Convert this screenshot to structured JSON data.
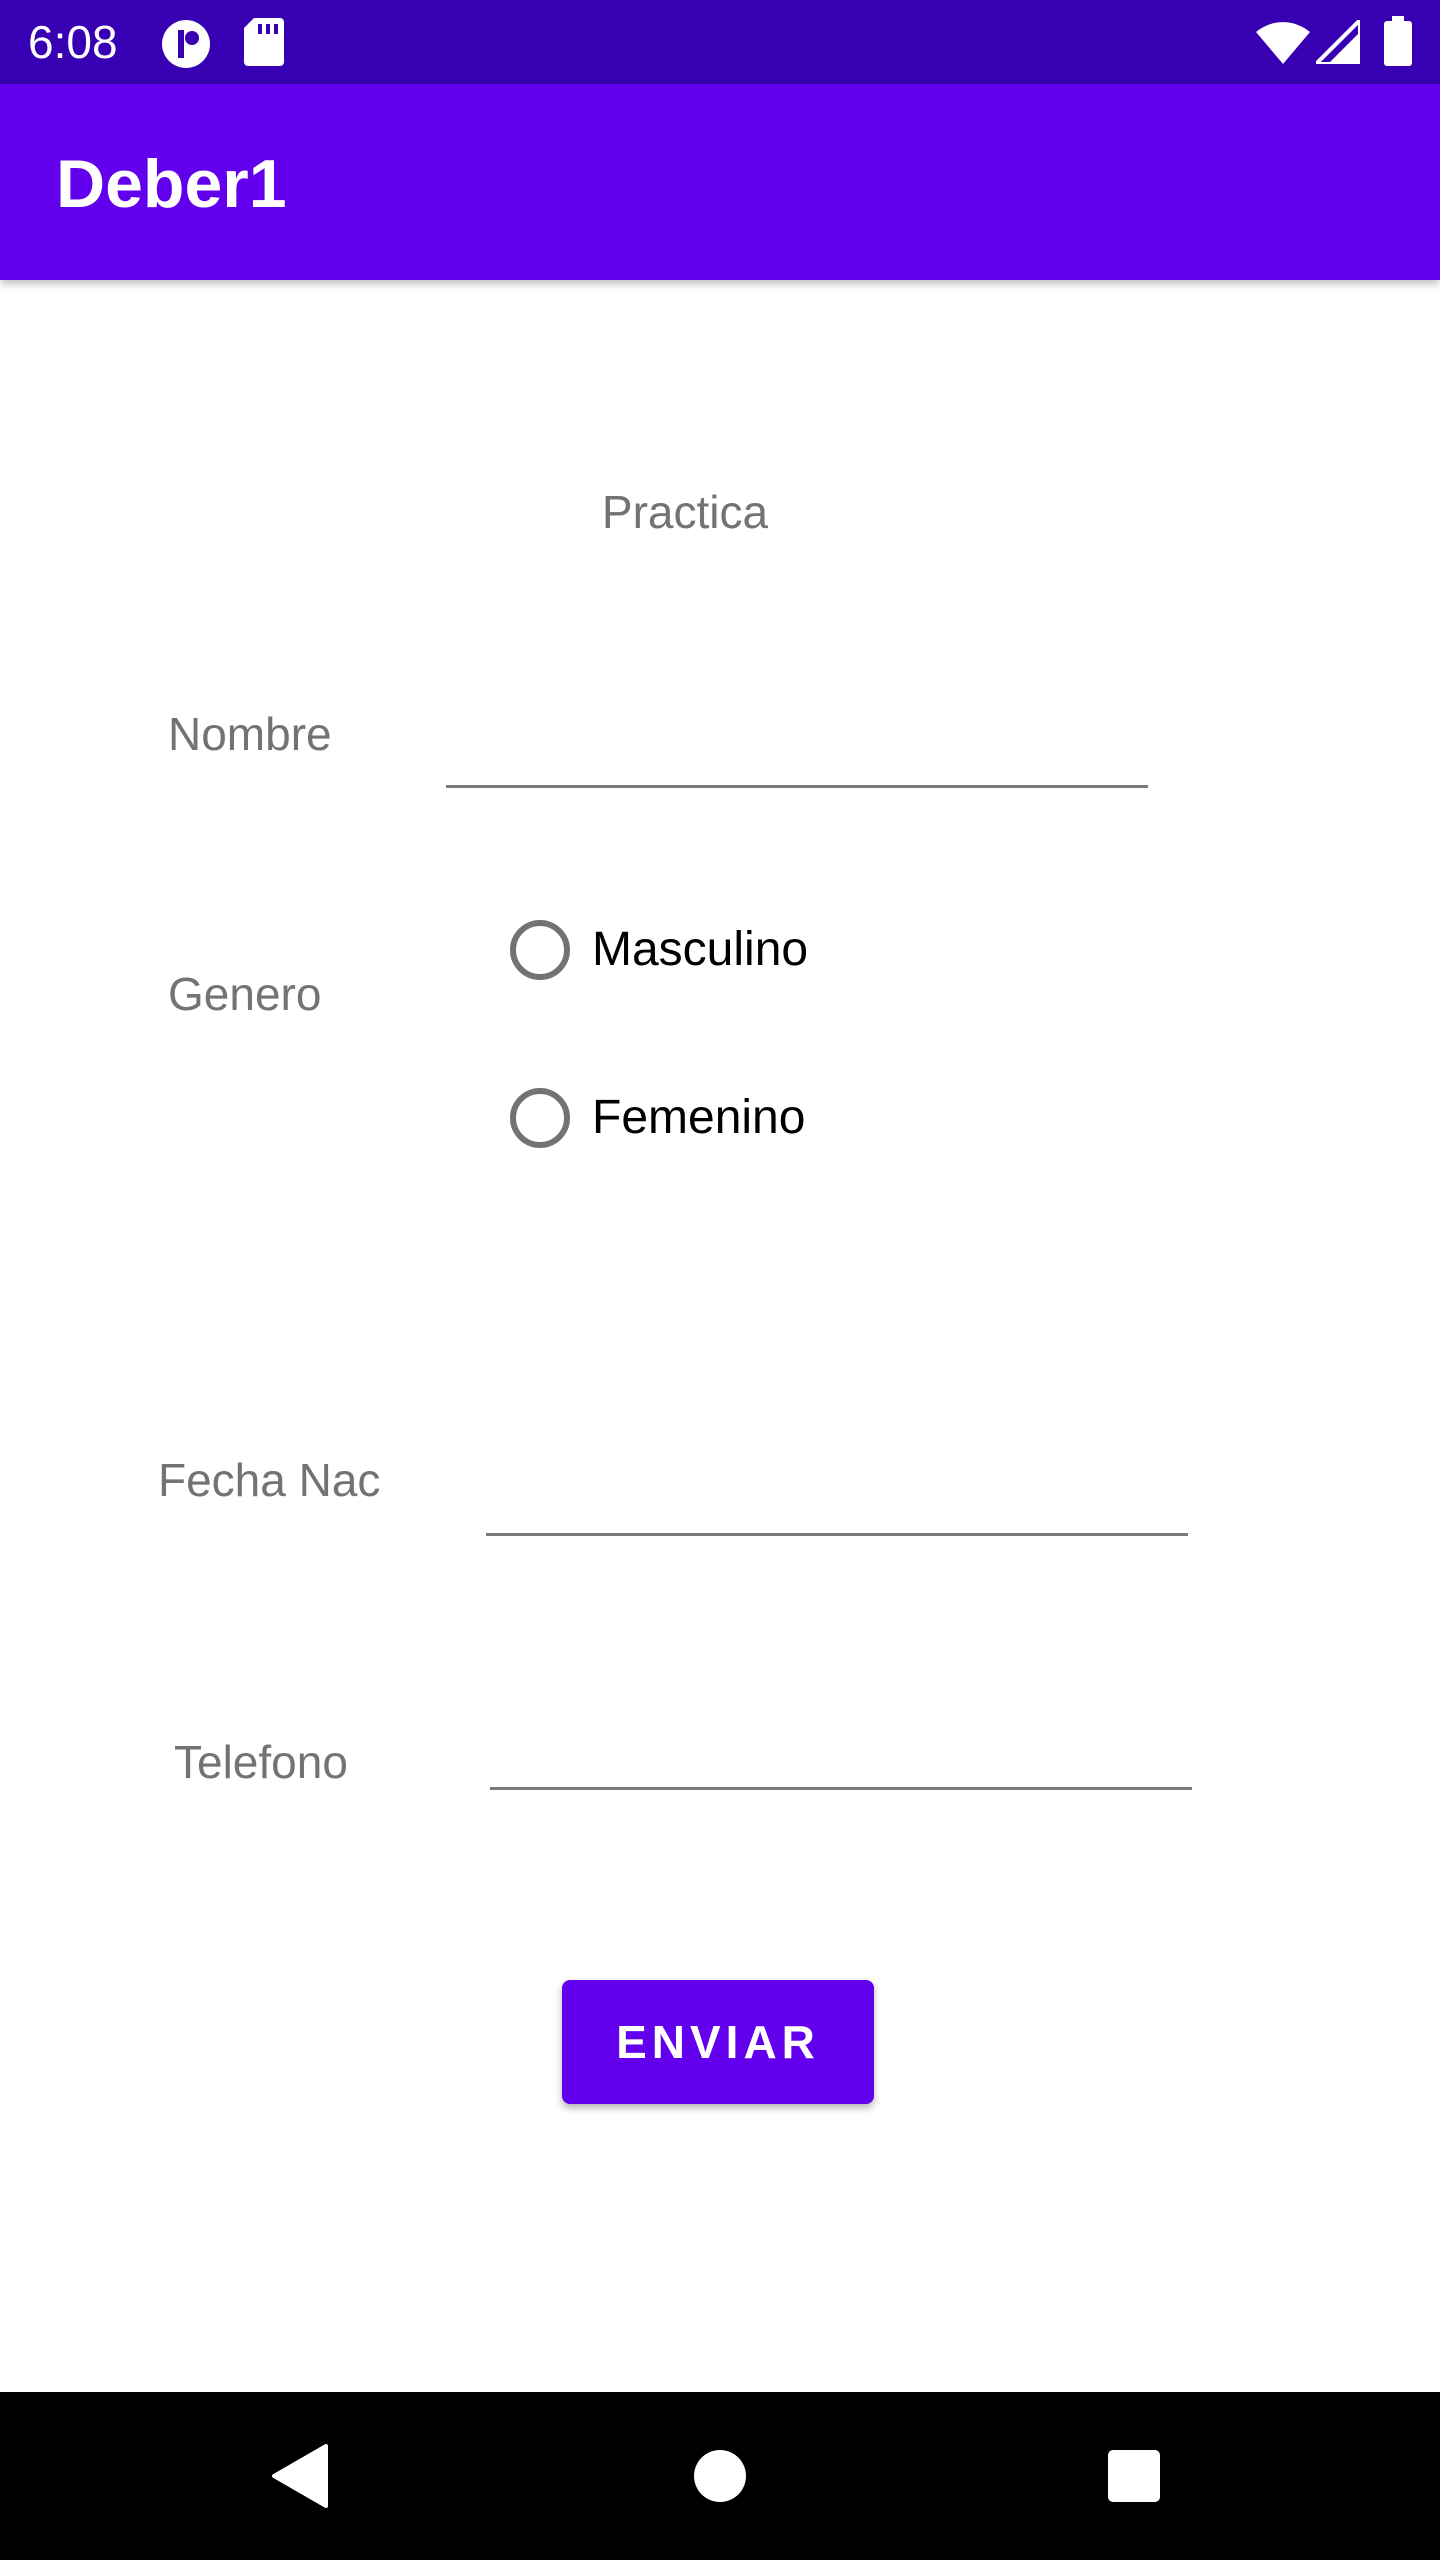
{
  "status_bar": {
    "time": "6:08",
    "icons": [
      "notification-app-icon",
      "sd-card-icon",
      "wifi-icon",
      "cell-signal-icon",
      "battery-icon"
    ]
  },
  "app_bar": {
    "title": "Deber1",
    "color": "#6200ee",
    "status_color": "#3700b3"
  },
  "form": {
    "heading": "Practica",
    "nombre_label": "Nombre",
    "nombre_value": "",
    "genero_label": "Genero",
    "genero_options": [
      "Masculino",
      "Femenino"
    ],
    "fecha_label": "Fecha Nac",
    "fecha_value": "",
    "telefono_label": "Telefono",
    "telefono_value": "",
    "submit_label": "ENVIAR"
  },
  "nav_bar": {
    "icons": [
      "back-icon",
      "home-icon",
      "recents-icon"
    ]
  }
}
